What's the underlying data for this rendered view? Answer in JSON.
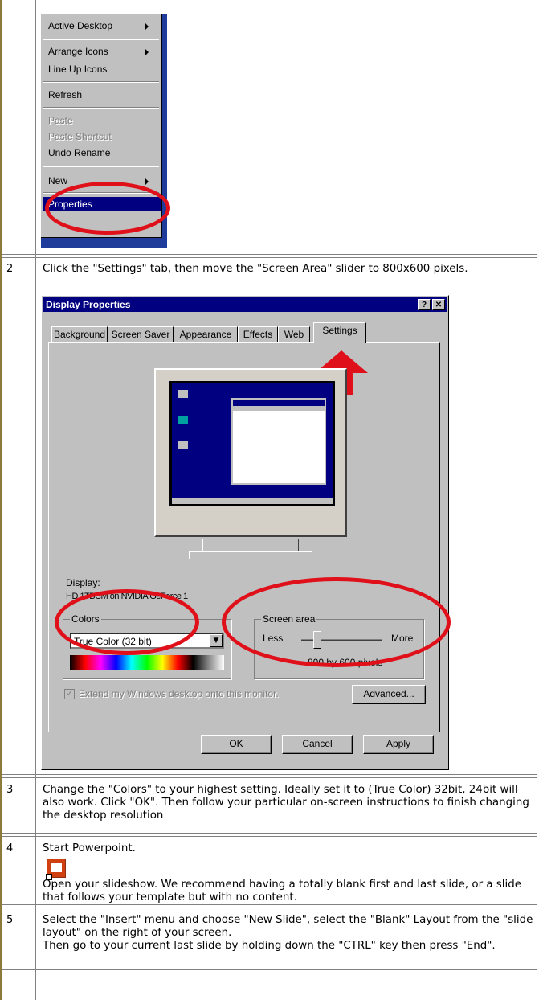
{
  "context_menu": {
    "items": [
      {
        "label": "Active Desktop",
        "submenu": true,
        "state": "normal"
      },
      {
        "label": "Arrange Icons",
        "submenu": true,
        "state": "normal"
      },
      {
        "label": "Line Up Icons",
        "submenu": false,
        "state": "normal"
      },
      {
        "label": "Refresh",
        "submenu": false,
        "state": "normal"
      },
      {
        "label": "Paste",
        "submenu": false,
        "state": "disabled"
      },
      {
        "label": "Paste Shortcut",
        "submenu": false,
        "state": "disabled"
      },
      {
        "label": "Undo Rename",
        "submenu": false,
        "state": "normal"
      },
      {
        "label": "New",
        "submenu": true,
        "state": "normal"
      },
      {
        "label": "Properties",
        "submenu": false,
        "state": "highlighted"
      }
    ]
  },
  "steps": [
    {
      "number": "2",
      "text": "Click the \"Settings\" tab, then move the \"Screen Area\" slider to 800x600 pixels."
    },
    {
      "number": "3",
      "text": "Change the \"Colors\" to your highest setting. Ideally set it to (True Color) 32bit, 24bit will also work. Click \"OK\". Then follow your particular on-screen instructions to finish changing the desktop resolution"
    },
    {
      "number": "4",
      "text": "Start Powerpoint.",
      "text2": "Open your slideshow. We recommend having a totally blank first and last slide, or a slide that follows your template but with no content."
    },
    {
      "number": "5",
      "text": "Select the \"Insert\" menu and choose \"New Slide\", select the \"Blank\" Layout from the \"slide layout\" on the right of your screen.",
      "text2": "Then go to your current last slide by holding down the \"CTRL\" key then press \"End\"."
    }
  ],
  "dialog": {
    "title": "Display Properties",
    "help_button": "?",
    "close_button": "✕",
    "tabs": [
      "Background",
      "Screen Saver",
      "Appearance",
      "Effects",
      "Web",
      "Settings"
    ],
    "active_tab": "Settings",
    "display_label": "Display:",
    "display_value": "HD 1TBCM on NVIDIA GeForce 1",
    "colors_label": "Colors",
    "colors_value": "True Color (32 bit)",
    "screen_area_label": "Screen area",
    "less_label": "Less",
    "more_label": "More",
    "resolution_text": "800 by 600 pixels",
    "resolution_level": 0.2,
    "extend_checkbox": "Extend my Windows desktop onto this monitor.",
    "extend_checked": true,
    "advanced_button": "Advanced...",
    "ok_button": "OK",
    "cancel_button": "Cancel",
    "apply_button": "Apply"
  },
  "colors": {
    "highlight_ring": "#e0101a",
    "arrow": "#e0101a",
    "titlebar": "#000080",
    "dialog_bg": "#c0c0c0"
  },
  "icons": {
    "powerpoint": "powerpoint-icon",
    "arrow": "red-up-arrow-icon"
  }
}
